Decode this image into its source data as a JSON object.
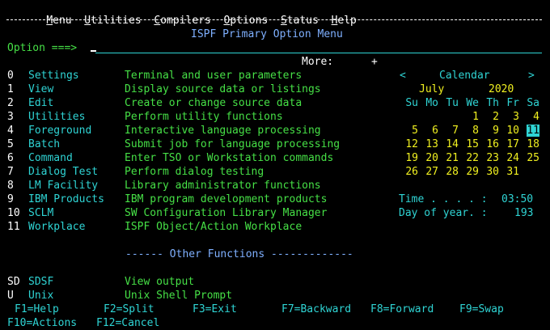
{
  "menubar": {
    "items": [
      {
        "hotkey": "M",
        "rest": "enu"
      },
      {
        "hotkey": "U",
        "rest": "tilities"
      },
      {
        "hotkey": "C",
        "rest": "ompilers"
      },
      {
        "hotkey": "O",
        "rest": "ptions"
      },
      {
        "hotkey": "S",
        "rest": "tatus"
      },
      {
        "hotkey": "H",
        "rest": "elp"
      }
    ]
  },
  "header": {
    "title": "ISPF Primary Option Menu"
  },
  "command": {
    "label": "Option ===>",
    "value": ""
  },
  "more": {
    "label": "More:",
    "indicator": "+"
  },
  "options": [
    {
      "code": "0",
      "name": "Settings",
      "desc": "Terminal and user parameters"
    },
    {
      "code": "1",
      "name": "View",
      "desc": "Display source data or listings"
    },
    {
      "code": "2",
      "name": "Edit",
      "desc": "Create or change source data"
    },
    {
      "code": "3",
      "name": "Utilities",
      "desc": "Perform utility functions"
    },
    {
      "code": "4",
      "name": "Foreground",
      "desc": "Interactive language processing"
    },
    {
      "code": "5",
      "name": "Batch",
      "desc": "Submit job for language processing"
    },
    {
      "code": "6",
      "name": "Command",
      "desc": "Enter TSO or Workstation commands"
    },
    {
      "code": "7",
      "name": "Dialog Test",
      "desc": "Perform dialog testing"
    },
    {
      "code": "8",
      "name": "LM Facility",
      "desc": "Library administrator functions"
    },
    {
      "code": "9",
      "name": "IBM Products",
      "desc": "IBM program development products"
    },
    {
      "code": "10",
      "name": "SCLM",
      "desc": "SW Configuration Library Manager"
    },
    {
      "code": "11",
      "name": "Workplace",
      "desc": "ISPF Object/Action Workplace"
    }
  ],
  "calendar": {
    "prev": "<",
    "title": "Calendar",
    "next": ">",
    "month": "July",
    "year": "2020",
    "weekdays": [
      "Su",
      "Mo",
      "Tu",
      "We",
      "Th",
      "Fr",
      "Sa"
    ],
    "weeks": [
      [
        "",
        "",
        "",
        "1",
        "2",
        "3",
        "4"
      ],
      [
        "5",
        "6",
        "7",
        "8",
        "9",
        "10",
        "11"
      ],
      [
        "12",
        "13",
        "14",
        "15",
        "16",
        "17",
        "18"
      ],
      [
        "19",
        "20",
        "21",
        "22",
        "23",
        "24",
        "25"
      ],
      [
        "26",
        "27",
        "28",
        "29",
        "30",
        "31",
        ""
      ]
    ],
    "today": "11",
    "time_label": "Time . . . . :",
    "time_value": "03:50",
    "doy_label": "Day of year. :",
    "doy_value": "193"
  },
  "other": {
    "heading": "------ Other Functions -------------",
    "items": [
      {
        "code": "SD",
        "name": "SDSF",
        "desc": "View output"
      },
      {
        "code": "U",
        "name": "Unix",
        "desc": "Unix Shell Prompt"
      }
    ]
  },
  "fkeys": {
    "row1": [
      "F1=Help",
      "F2=Split",
      "F3=Exit",
      "F7=Backward",
      "F8=Forward",
      "F9=Swap"
    ],
    "row2": [
      "F10=Actions",
      "F12=Cancel"
    ]
  },
  "colors": {
    "background": "#000000",
    "turquoise": "#2fd4d4",
    "green": "#46e046",
    "yellow": "#f0f020",
    "white": "#ffffff"
  }
}
